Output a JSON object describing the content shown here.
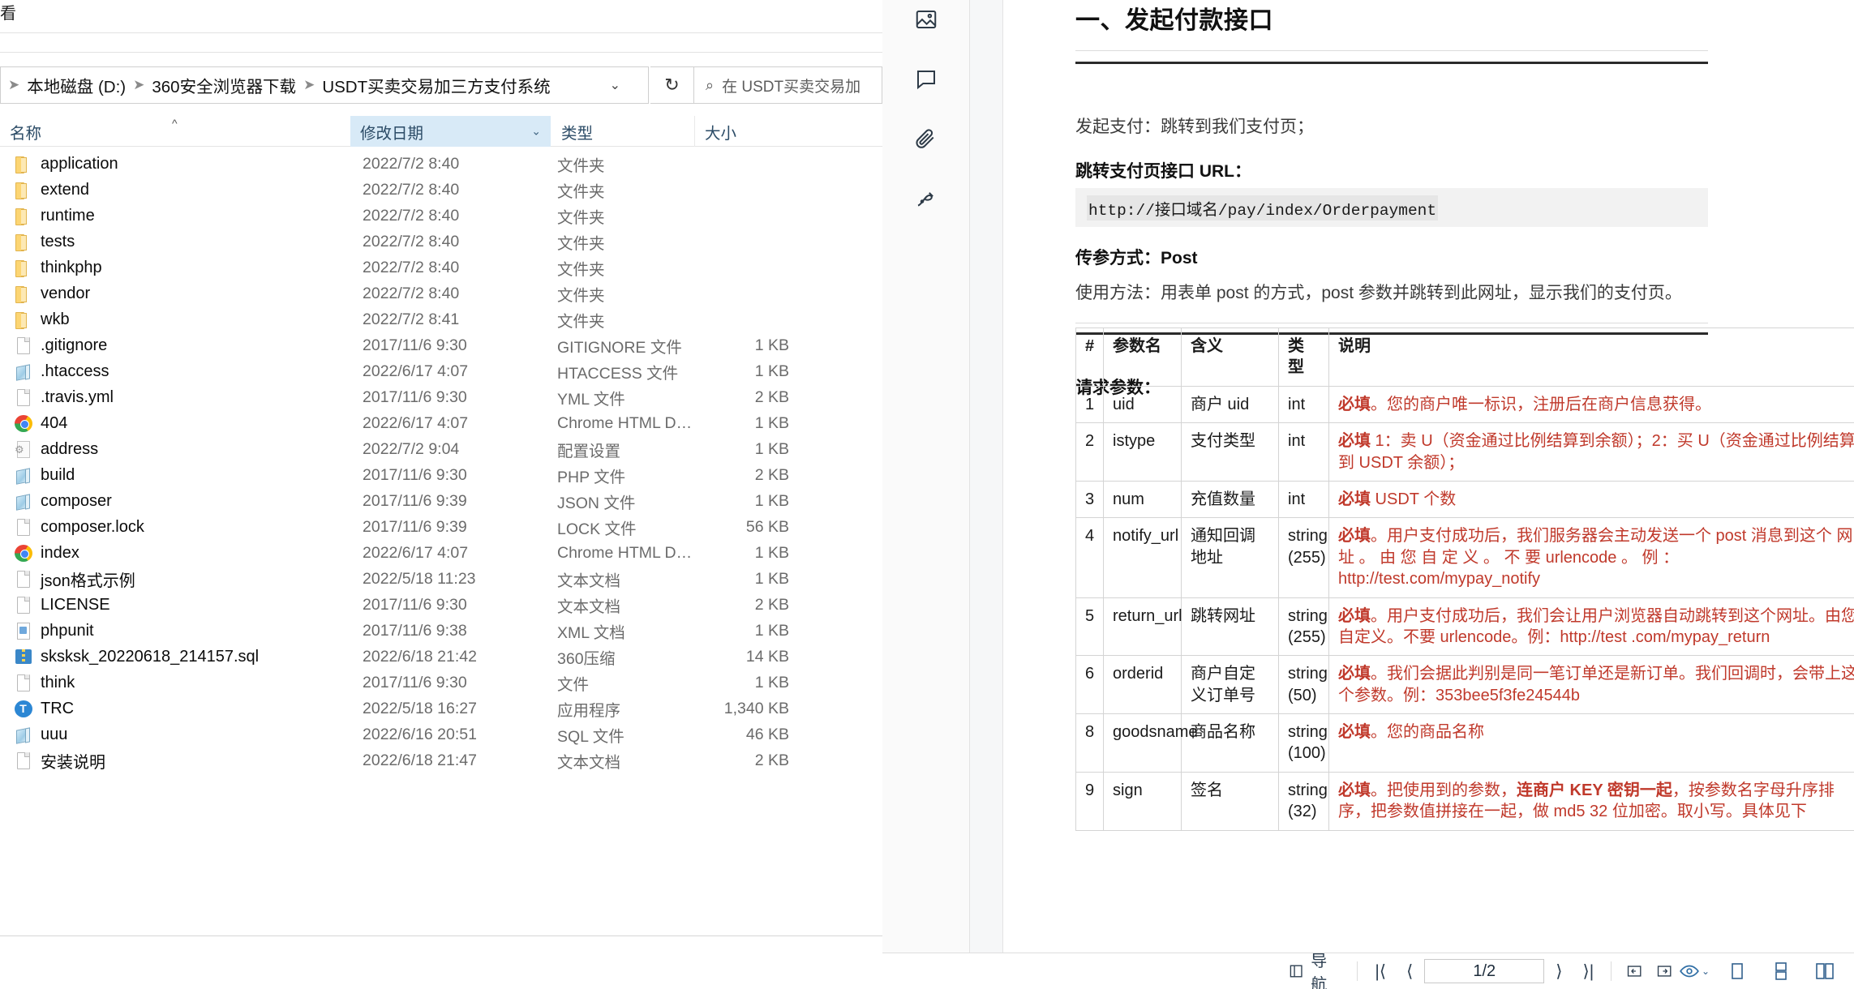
{
  "explorer": {
    "top_label": "看",
    "breadcrumb": [
      "本地磁盘 (D:)",
      "360安全浏览器下载",
      "USDT买卖交易加三方支付系统"
    ],
    "breadcrumb_caret": "⌄",
    "refresh_icon": "↻",
    "search_placeholder": "在 USDT买卖交易加",
    "search_icon": "⌕",
    "columns": {
      "name": "名称",
      "date": "修改日期",
      "type": "类型",
      "size": "大小",
      "sort_mark": "^",
      "chevron": "⌄"
    },
    "files": [
      {
        "name": "application",
        "date": "2022/7/2 8:40",
        "type": "文件夹",
        "size": "",
        "icon": "folder-icon"
      },
      {
        "name": "extend",
        "date": "2022/7/2 8:40",
        "type": "文件夹",
        "size": "",
        "icon": "folder-icon"
      },
      {
        "name": "runtime",
        "date": "2022/7/2 8:40",
        "type": "文件夹",
        "size": "",
        "icon": "folder-icon"
      },
      {
        "name": "tests",
        "date": "2022/7/2 8:40",
        "type": "文件夹",
        "size": "",
        "icon": "folder-icon"
      },
      {
        "name": "thinkphp",
        "date": "2022/7/2 8:40",
        "type": "文件夹",
        "size": "",
        "icon": "folder-icon"
      },
      {
        "name": "vendor",
        "date": "2022/7/2 8:40",
        "type": "文件夹",
        "size": "",
        "icon": "folder-icon"
      },
      {
        "name": "wkb",
        "date": "2022/7/2 8:41",
        "type": "文件夹",
        "size": "",
        "icon": "folder-icon"
      },
      {
        "name": ".gitignore",
        "date": "2017/11/6 9:30",
        "type": "GITIGNORE 文件",
        "size": "1 KB",
        "icon": "document-icon"
      },
      {
        "name": ".htaccess",
        "date": "2022/6/17 4:07",
        "type": "HTACCESS 文件",
        "size": "1 KB",
        "icon": "php-file-icon"
      },
      {
        "name": ".travis.yml",
        "date": "2017/11/6 9:30",
        "type": "YML 文件",
        "size": "2 KB",
        "icon": "document-icon"
      },
      {
        "name": "404",
        "date": "2022/6/17 4:07",
        "type": "Chrome HTML Doc...",
        "size": "1 KB",
        "icon": "chrome-icon"
      },
      {
        "name": "address",
        "date": "2022/7/2 9:04",
        "type": "配置设置",
        "size": "1 KB",
        "icon": "config-icon"
      },
      {
        "name": "build",
        "date": "2017/11/6 9:30",
        "type": "PHP 文件",
        "size": "2 KB",
        "icon": "php-file-icon"
      },
      {
        "name": "composer",
        "date": "2017/11/6 9:39",
        "type": "JSON 文件",
        "size": "1 KB",
        "icon": "php-file-icon"
      },
      {
        "name": "composer.lock",
        "date": "2017/11/6 9:39",
        "type": "LOCK 文件",
        "size": "56 KB",
        "icon": "document-icon"
      },
      {
        "name": "index",
        "date": "2022/6/17 4:07",
        "type": "Chrome HTML Doc...",
        "size": "1 KB",
        "icon": "chrome-icon"
      },
      {
        "name": "json格式示例",
        "date": "2022/5/18 11:23",
        "type": "文本文档",
        "size": "1 KB",
        "icon": "document-icon"
      },
      {
        "name": "LICENSE",
        "date": "2017/11/6 9:30",
        "type": "文本文档",
        "size": "2 KB",
        "icon": "document-icon"
      },
      {
        "name": "phpunit",
        "date": "2017/11/6 9:38",
        "type": "XML 文档",
        "size": "1 KB",
        "icon": "xml-icon"
      },
      {
        "name": "sksksk_20220618_214157.sql",
        "date": "2022/6/18 21:42",
        "type": "360压缩",
        "size": "14 KB",
        "icon": "zip-icon"
      },
      {
        "name": "think",
        "date": "2017/11/6 9:30",
        "type": "文件",
        "size": "1 KB",
        "icon": "document-icon"
      },
      {
        "name": "TRC",
        "date": "2022/5/18 16:27",
        "type": "应用程序",
        "size": "1,340 KB",
        "icon": "trc-app-icon"
      },
      {
        "name": "uuu",
        "date": "2022/6/16 20:51",
        "type": "SQL 文件",
        "size": "46 KB",
        "icon": "php-file-icon"
      },
      {
        "name": "安装说明",
        "date": "2022/6/18 21:47",
        "type": "文本文档",
        "size": "2 KB",
        "icon": "document-icon"
      }
    ]
  },
  "pdf": {
    "tools": [
      "image-tool-icon",
      "comment-tool-icon",
      "attachment-tool-icon",
      "signature-tool-icon"
    ],
    "document": {
      "heading": "一、发起付款接口",
      "intro": "发起支付：跳转到我们支付页；",
      "url_label": "跳转支付页接口 URL：",
      "url_value": "http://接口域名/pay/index/Orderpayment",
      "method_label": "传参方式：Post",
      "usage": "使用方法：用表单 post 的方式，post 参数并跳转到此网址，显示我们的支付页。",
      "params_title": "请求参数：",
      "table": {
        "headers": [
          "#",
          "参数名",
          "含义",
          "类型",
          "说明"
        ],
        "rows": [
          {
            "no": "1",
            "param": "uid",
            "meaning": "商户 uid",
            "type": "int",
            "desc_req": "必填",
            "desc": "。您的商户唯一标识，注册后在商户信息获得。"
          },
          {
            "no": "2",
            "param": "istype",
            "meaning": "支付类型",
            "type": "int",
            "desc_req": "必填",
            "desc": " 1：卖 U（资金通过比例结算到余额）；2：买 U（资金通过比例结算到 USDT 余额）；"
          },
          {
            "no": "3",
            "param": "num",
            "meaning": "充值数量",
            "type": "int",
            "desc_req": "必填",
            "desc": " USDT 个数"
          },
          {
            "no": "4",
            "param": "notify_url",
            "meaning": "通知回调地址",
            "type": "string (255)",
            "desc_req": "必填",
            "desc": "。用户支付成功后，我们服务器会主动发送一个 post 消息到这个 网 址 。 由 您 自 定 义 。 不 要 urlencode 。 例 ： http://test.com/mypay_notify"
          },
          {
            "no": "5",
            "param": "return_url",
            "meaning": "跳转网址",
            "type": "string (255)",
            "desc_req": "必填",
            "desc": "。用户支付成功后，我们会让用户浏览器自动跳转到这个网址。由您自定义。不要 urlencode。例：http://test .com/mypay_return"
          },
          {
            "no": "6",
            "param": "orderid",
            "meaning": "商户自定义订单号",
            "type": "string (50)",
            "desc_req": "必填",
            "desc": "。我们会据此判别是同一笔订单还是新订单。我们回调时，会带上这个参数。例：353bee5f3fe24544b"
          },
          {
            "no": "8",
            "param": "goodsname",
            "meaning": "商品名称",
            "type": "string (100)",
            "desc_req": "必填",
            "desc": "。您的商品名称"
          },
          {
            "no": "9",
            "param": "sign",
            "meaning": "签名",
            "type": "string (32)",
            "desc_req": "必填",
            "desc": "。把使用到的参数，",
            "desc_bold": "连商户 KEY 密钥一起",
            "desc_tail": "，按参数名字母升序排序，把参数值拼接在一起，做 md5 32 位加密。取小写。具体见下"
          }
        ]
      }
    },
    "bottom_bar": {
      "nav_label": "导航",
      "nav_icon": "panel-icon",
      "first_page_icon": "|⟨",
      "prev_page_icon": "⟨",
      "page_value": "1/2",
      "next_page_icon": "⟩",
      "last_page_icon": "⟩|",
      "fit_width_icon": "⬅",
      "fit_page_icon": "➡",
      "view_icon": "eye-icon",
      "view_caret": "⌄",
      "single_page_icon": "single-page-icon",
      "continuous_icon": "continuous-page-icon",
      "facing_icon": "facing-page-icon"
    }
  }
}
